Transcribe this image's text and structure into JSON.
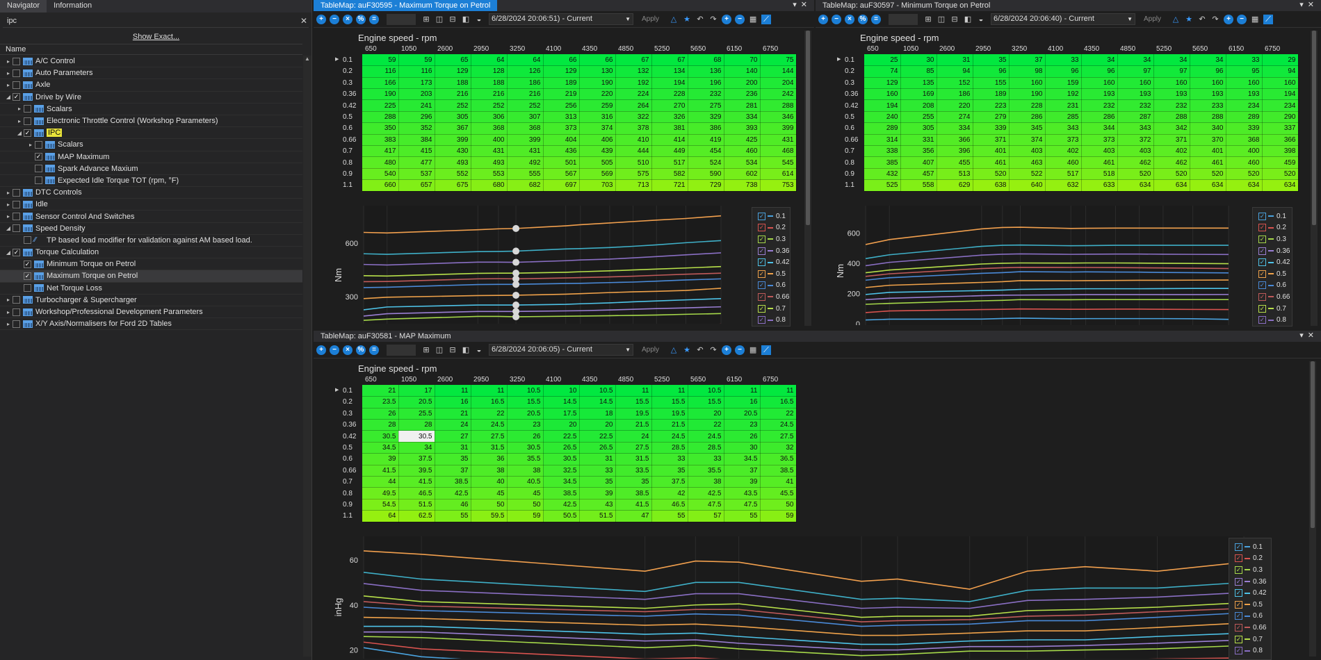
{
  "nav": {
    "tabs": [
      "Navigator",
      "Information"
    ],
    "search_value": "ipc",
    "show_exact": "Show Exact...",
    "column_header": "Name",
    "items": [
      {
        "label": "A/C Control",
        "level": 0,
        "arrow": "▸",
        "check": false,
        "icon": "table"
      },
      {
        "label": "Auto Parameters",
        "level": 0,
        "arrow": "▸",
        "check": false,
        "icon": "table"
      },
      {
        "label": "Axle",
        "level": 0,
        "arrow": "▸",
        "check": false,
        "icon": "table"
      },
      {
        "label": "Drive by Wire",
        "level": 0,
        "arrow": "◢",
        "check": true,
        "icon": "table"
      },
      {
        "label": "Scalars",
        "level": 1,
        "arrow": "▸",
        "check": false,
        "icon": "table"
      },
      {
        "label": "Electronic Throttle Control (Workshop Parameters)",
        "level": 1,
        "arrow": "▸",
        "check": false,
        "icon": "table"
      },
      {
        "label": "IPC",
        "level": 1,
        "arrow": "◢",
        "check": true,
        "icon": "table",
        "highlight": true
      },
      {
        "label": "Scalars",
        "level": 2,
        "arrow": "▸",
        "check": false,
        "icon": "table"
      },
      {
        "label": "MAP Maximum",
        "level": 2,
        "arrow": "",
        "check": true,
        "icon": "table"
      },
      {
        "label": "Spark Advance Maxium",
        "level": 2,
        "arrow": "",
        "check": false,
        "icon": "table"
      },
      {
        "label": "Expected Idle Torque TOT (rpm, °F)",
        "level": 2,
        "arrow": "",
        "check": false,
        "icon": "table"
      },
      {
        "label": "DTC Controls",
        "level": 0,
        "arrow": "▸",
        "check": false,
        "icon": "table"
      },
      {
        "label": "Idle",
        "level": 0,
        "arrow": "▸",
        "check": false,
        "icon": "table"
      },
      {
        "label": "Sensor Control And Switches",
        "level": 0,
        "arrow": "▸",
        "check": false,
        "icon": "table"
      },
      {
        "label": "Speed Density",
        "level": 0,
        "arrow": "◢",
        "check": false,
        "icon": "table"
      },
      {
        "label": "TP based load modifier for validation against AM based load.",
        "level": 1,
        "arrow": "",
        "check": false,
        "icon": "fn"
      },
      {
        "label": "Torque Calculation",
        "level": 0,
        "arrow": "◢",
        "check": true,
        "icon": "table"
      },
      {
        "label": "Minimum Torque on Petrol",
        "level": 1,
        "arrow": "",
        "check": true,
        "icon": "table"
      },
      {
        "label": "Maximum Torque on Petrol",
        "level": 1,
        "arrow": "",
        "check": true,
        "icon": "table",
        "selected": true
      },
      {
        "label": "Net Torque Loss",
        "level": 1,
        "arrow": "",
        "check": false,
        "icon": "table"
      },
      {
        "label": "Turbocharger & Supercharger",
        "level": 0,
        "arrow": "▸",
        "check": false,
        "icon": "table"
      },
      {
        "label": "Workshop/Professional Development Parameters",
        "level": 0,
        "arrow": "▸",
        "check": false,
        "icon": "table"
      },
      {
        "label": "X/Y Axis/Normalisers for Ford 2D Tables",
        "level": 0,
        "arrow": "▸",
        "check": false,
        "icon": "table"
      }
    ]
  },
  "common": {
    "apply_label": "Apply",
    "x_axis_title": "Engine speed - rpm",
    "columns": [
      "650",
      "1050",
      "2600",
      "2950",
      "3250",
      "4100",
      "4350",
      "4850",
      "5250",
      "5650",
      "6150",
      "6750"
    ],
    "rows": [
      "0.1",
      "0.2",
      "0.3",
      "0.36",
      "0.42",
      "0.5",
      "0.6",
      "0.66",
      "0.7",
      "0.8",
      "0.9",
      "1.1"
    ],
    "legend": [
      "0.1",
      "0.2",
      "0.3",
      "0.36",
      "0.42",
      "0.5",
      "0.6",
      "0.66",
      "0.7",
      "0.8"
    ],
    "series_colors": [
      "#4aa3df",
      "#d9534f",
      "#a6d94a",
      "#9b7fd4",
      "#4ec3e8",
      "#f0a24a",
      "#4a8ad8",
      "#c05a5a",
      "#b7e04a",
      "#8a6fc4",
      "#3fb0c8",
      "#f2a04e"
    ]
  },
  "panels": {
    "max_torque": {
      "title": "TableMap: auF30595 - Maximum Torque on Petrol",
      "date": "6/28/2024 20:06:51) - Current",
      "ylabel": "Nm",
      "yticks": [
        "600",
        "300"
      ],
      "values": [
        [
          59,
          59,
          65,
          64,
          64,
          66,
          66,
          67,
          67,
          68,
          70,
          75
        ],
        [
          116,
          116,
          129,
          128,
          126,
          129,
          130,
          132,
          134,
          136,
          140,
          144
        ],
        [
          166,
          173,
          188,
          188,
          186,
          189,
          190,
          192,
          194,
          196,
          200,
          204
        ],
        [
          190,
          203,
          216,
          216,
          216,
          219,
          220,
          224,
          228,
          232,
          236,
          242
        ],
        [
          225,
          241,
          252,
          252,
          252,
          256,
          259,
          264,
          270,
          275,
          281,
          288
        ],
        [
          288,
          296,
          305,
          306,
          307,
          313,
          316,
          322,
          326,
          329,
          334,
          346
        ],
        [
          350,
          352,
          367,
          368,
          368,
          373,
          374,
          378,
          381,
          386,
          393,
          399
        ],
        [
          383,
          384,
          399,
          400,
          399,
          404,
          406,
          410,
          414,
          419,
          425,
          431
        ],
        [
          417,
          415,
          430,
          431,
          431,
          436,
          439,
          444,
          449,
          454,
          460,
          468
        ],
        [
          480,
          477,
          493,
          493,
          492,
          501,
          505,
          510,
          517,
          524,
          534,
          545
        ],
        [
          540,
          537,
          552,
          553,
          555,
          567,
          569,
          575,
          582,
          590,
          602,
          614
        ],
        [
          660,
          657,
          675,
          680,
          682,
          697,
          703,
          713,
          721,
          729,
          738,
          753
        ]
      ]
    },
    "min_torque": {
      "title": "TableMap: auF30597 - Minimum Torque on Petrol",
      "date": "6/28/2024 20:06:40) - Current",
      "ylabel": "Nm",
      "yticks": [
        "600",
        "400",
        "200",
        "0"
      ],
      "values": [
        [
          25,
          30,
          31,
          35,
          37,
          33,
          34,
          34,
          34,
          34,
          33,
          29
        ],
        [
          74,
          85,
          94,
          96,
          98,
          96,
          96,
          97,
          97,
          96,
          95,
          94
        ],
        [
          129,
          135,
          152,
          155,
          160,
          159,
          160,
          160,
          160,
          160,
          160,
          160
        ],
        [
          160,
          169,
          186,
          189,
          190,
          192,
          193,
          193,
          193,
          193,
          193,
          194
        ],
        [
          194,
          208,
          220,
          223,
          228,
          231,
          232,
          232,
          232,
          233,
          234,
          234
        ],
        [
          240,
          255,
          274,
          279,
          286,
          285,
          286,
          287,
          288,
          288,
          289,
          290
        ],
        [
          289,
          305,
          334,
          339,
          345,
          343,
          344,
          343,
          342,
          340,
          339,
          337
        ],
        [
          314,
          331,
          366,
          371,
          374,
          373,
          373,
          372,
          371,
          370,
          368,
          366
        ],
        [
          338,
          356,
          396,
          401,
          403,
          402,
          403,
          403,
          402,
          401,
          400,
          398
        ],
        [
          385,
          407,
          455,
          461,
          463,
          460,
          461,
          462,
          462,
          461,
          460,
          459
        ],
        [
          432,
          457,
          513,
          520,
          522,
          517,
          518,
          520,
          520,
          520,
          520,
          520
        ],
        [
          525,
          558,
          629,
          638,
          640,
          632,
          633,
          634,
          634,
          634,
          634,
          634
        ]
      ]
    },
    "map_max": {
      "title": "TableMap: auF30581 - MAP Maximum",
      "date": "6/28/2024 20:06:05) - Current",
      "ylabel": "inHg",
      "yticks": [
        "60",
        "40",
        "20"
      ],
      "values": [
        [
          "21",
          "17",
          "11",
          "11",
          "10.5",
          "10",
          "10.5",
          "11",
          "11",
          "10.5",
          "11",
          "11"
        ],
        [
          "23.5",
          "20.5",
          "16",
          "16.5",
          "15.5",
          "14.5",
          "14.5",
          "15.5",
          "15.5",
          "15.5",
          "16",
          "16.5"
        ],
        [
          "26",
          "25.5",
          "21",
          "22",
          "20.5",
          "17.5",
          "18",
          "19.5",
          "19.5",
          "20",
          "20.5",
          "22"
        ],
        [
          "28",
          "28",
          "24",
          "24.5",
          "23",
          "20",
          "20",
          "21.5",
          "21.5",
          "22",
          "23",
          "24.5"
        ],
        [
          "30.5",
          "30.5",
          "27",
          "27.5",
          "26",
          "22.5",
          "22.5",
          "24",
          "24.5",
          "24.5",
          "26",
          "27.5"
        ],
        [
          "34.5",
          "34",
          "31",
          "31.5",
          "30.5",
          "26.5",
          "26.5",
          "27.5",
          "28.5",
          "28.5",
          "30",
          "32"
        ],
        [
          "39",
          "37.5",
          "35",
          "36",
          "35.5",
          "30.5",
          "31",
          "31.5",
          "33",
          "33",
          "34.5",
          "36.5"
        ],
        [
          "41.5",
          "39.5",
          "37",
          "38",
          "38",
          "32.5",
          "33",
          "33.5",
          "35",
          "35.5",
          "37",
          "38.5"
        ],
        [
          "44",
          "41.5",
          "38.5",
          "40",
          "40.5",
          "34.5",
          "35",
          "35",
          "37.5",
          "38",
          "39",
          "41"
        ],
        [
          "49.5",
          "46.5",
          "42.5",
          "45",
          "45",
          "38.5",
          "39",
          "38.5",
          "42",
          "42.5",
          "43.5",
          "45.5"
        ],
        [
          "54.5",
          "51.5",
          "46",
          "50",
          "50",
          "42.5",
          "43",
          "41.5",
          "46.5",
          "47.5",
          "47.5",
          "50"
        ],
        [
          "64",
          "62.5",
          "55",
          "59.5",
          "59",
          "50.5",
          "51.5",
          "47",
          "55",
          "57",
          "55",
          "59"
        ]
      ]
    }
  }
}
